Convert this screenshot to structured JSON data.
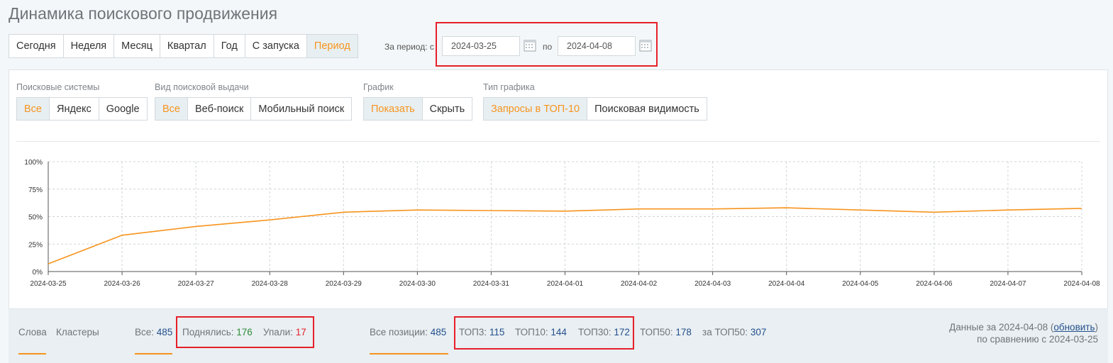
{
  "page": {
    "title": "Динамика поискового продвижения"
  },
  "period_tabs": [
    {
      "label": "Сегодня",
      "active": false
    },
    {
      "label": "Неделя",
      "active": false
    },
    {
      "label": "Месяц",
      "active": false
    },
    {
      "label": "Квартал",
      "active": false
    },
    {
      "label": "Год",
      "active": false
    },
    {
      "label": "С запуска",
      "active": false
    },
    {
      "label": "Период",
      "active": true
    }
  ],
  "date_range": {
    "label": "За период: с",
    "from": "2024-03-25",
    "to_label": "по",
    "to": "2024-04-08"
  },
  "filters": {
    "search_engines": {
      "label": "Поисковые системы",
      "options": [
        "Все",
        "Яндекс",
        "Google"
      ],
      "active": "Все"
    },
    "serp_type": {
      "label": "Вид поисковой выдачи",
      "options": [
        "Все",
        "Веб-поиск",
        "Мобильный поиск"
      ],
      "active": "Все"
    },
    "chart_toggle": {
      "label": "График",
      "options": [
        "Показать",
        "Скрыть"
      ],
      "active": "Показать"
    },
    "chart_type": {
      "label": "Тип графика",
      "options": [
        "Запросы в ТОП-10",
        "Поисковая видимость"
      ],
      "active": "Запросы в ТОП-10"
    }
  },
  "chart_data": {
    "type": "line",
    "x": [
      "2024-03-25",
      "2024-03-26",
      "2024-03-27",
      "2024-03-28",
      "2024-03-29",
      "2024-03-30",
      "2024-03-31",
      "2024-04-01",
      "2024-04-02",
      "2024-04-03",
      "2024-04-04",
      "2024-04-05",
      "2024-04-06",
      "2024-04-07",
      "2024-04-08"
    ],
    "series": [
      {
        "values": [
          7,
          33,
          41,
          47,
          54,
          56,
          55.5,
          55,
          57,
          57,
          58,
          56,
          54,
          56,
          57.5
        ],
        "color": "#f7941d"
      }
    ],
    "yticks": [
      "0%",
      "25%",
      "50%",
      "75%",
      "100%"
    ],
    "ylim": [
      0,
      100
    ],
    "grid": true
  },
  "bottom": {
    "tabs": [
      "Слова",
      "Кластеры"
    ],
    "all": {
      "label": "Все:",
      "value": "485"
    },
    "up": {
      "label": "Поднялись:",
      "value": "176"
    },
    "down": {
      "label": "Упали:",
      "value": "17"
    },
    "positions": {
      "label": "Все позиции:",
      "value": "485"
    },
    "top3": {
      "label": "ТОП3:",
      "value": "115"
    },
    "top10": {
      "label": "ТОП10:",
      "value": "144"
    },
    "top30": {
      "label": "ТОП30:",
      "value": "172"
    },
    "top50": {
      "label": "ТОП50:",
      "value": "178"
    },
    "beyond": {
      "label": "за ТОП50:",
      "value": "307"
    },
    "info_line1_prefix": "Данные за 2024-04-08 (",
    "info_link": "обновить",
    "info_line1_suffix": ")",
    "info_line2": "по сравнению с 2024-03-25"
  },
  "colors": {
    "accent": "#f7941d",
    "highlight": "#e6202a",
    "value_blue": "#234f8c",
    "up_green": "#2e8b3a"
  }
}
